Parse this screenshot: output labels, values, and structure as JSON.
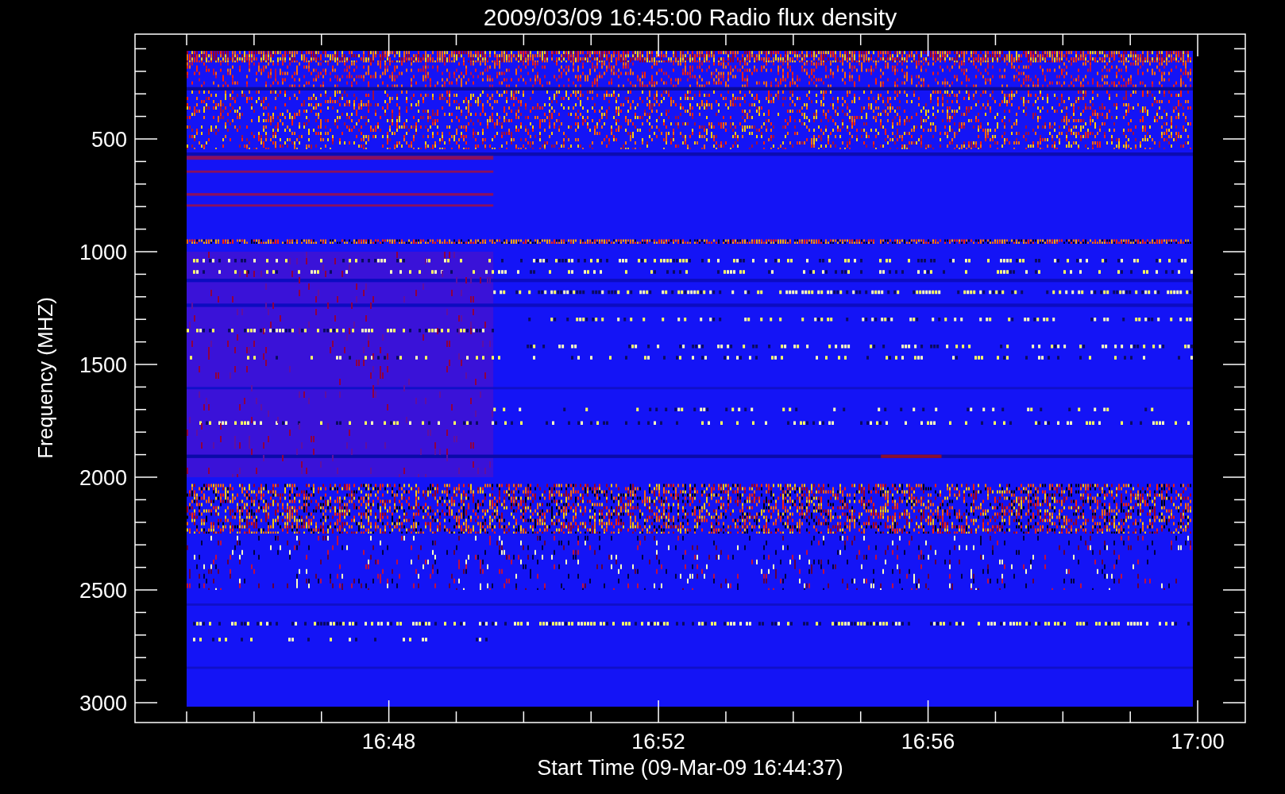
{
  "title": "2009/03/09 16:45:00 Radio flux density",
  "y_axis": {
    "label": "Frequency (MHZ)",
    "ticks": [
      "500",
      "1000",
      "1500",
      "2000",
      "2500",
      "3000"
    ]
  },
  "x_axis": {
    "label": "Start Time (09-Mar-09 16:44:37)",
    "ticks": [
      "16:48",
      "16:52",
      "16:56",
      "17:00"
    ]
  }
}
